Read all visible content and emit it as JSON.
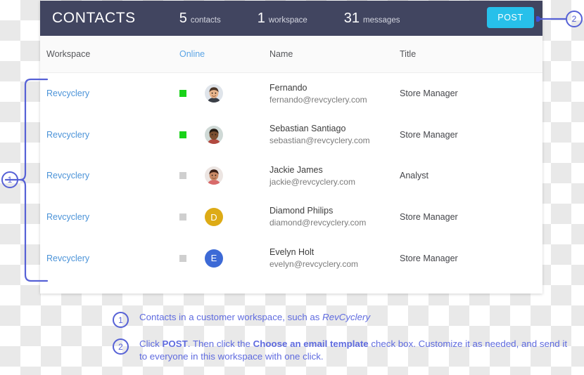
{
  "header": {
    "title": "CONTACTS",
    "stats": [
      {
        "num": "5",
        "label": "contacts"
      },
      {
        "num": "1",
        "label": "workspace"
      },
      {
        "num": "31",
        "label": "messages"
      }
    ],
    "post_label": "POST",
    "post_color": "#27c0ea",
    "bar_color": "#414560"
  },
  "table": {
    "columns": [
      "Workspace",
      "Online",
      "Name",
      "Title"
    ],
    "online_column_accent": "#5ba4e5",
    "rows": [
      {
        "workspace": "Revcyclery",
        "online": true,
        "avatar_type": "photo",
        "avatar_variant": "man-light",
        "name": "Fernando",
        "email": "fernando@revcyclery.com",
        "title": "Store Manager"
      },
      {
        "workspace": "Revcyclery",
        "online": true,
        "avatar_type": "photo",
        "avatar_variant": "man-dark",
        "name": "Sebastian Santiago",
        "email": "sebastian@revcyclery.com",
        "title": "Store Manager"
      },
      {
        "workspace": "Revcyclery",
        "online": false,
        "avatar_type": "photo",
        "avatar_variant": "woman",
        "name": "Jackie James",
        "email": "jackie@revcyclery.com",
        "title": "Analyst"
      },
      {
        "workspace": "Revcyclery",
        "online": false,
        "avatar_type": "initial",
        "avatar_initial": "D",
        "avatar_color": "#ddab16",
        "name": "Diamond Philips",
        "email": "diamond@revcyclery.com",
        "title": "Store Manager"
      },
      {
        "workspace": "Revcyclery",
        "online": false,
        "avatar_type": "initial",
        "avatar_initial": "E",
        "avatar_color": "#3d6ad6",
        "name": "Evelyn Holt",
        "email": "evelyn@revcyclery.com",
        "title": "Store Manager"
      }
    ]
  },
  "callouts": {
    "marker_color": "#5661d6",
    "one": "1",
    "two": "2"
  },
  "notes": [
    {
      "marker": "1",
      "parts": [
        {
          "text": "Contacts in a customer workspace, such as ",
          "style": "normal"
        },
        {
          "text": "RevCyclery",
          "style": "italic"
        }
      ]
    },
    {
      "marker": "2",
      "parts": [
        {
          "text": "Click ",
          "style": "normal"
        },
        {
          "text": "POST",
          "style": "bold"
        },
        {
          "text": ".  Then click the ",
          "style": "normal"
        },
        {
          "text": "Choose an email template",
          "style": "bold"
        },
        {
          "text": " check box. Customize it as needed, and send it to everyone in this workspace with one click.",
          "style": "normal"
        }
      ]
    }
  ]
}
